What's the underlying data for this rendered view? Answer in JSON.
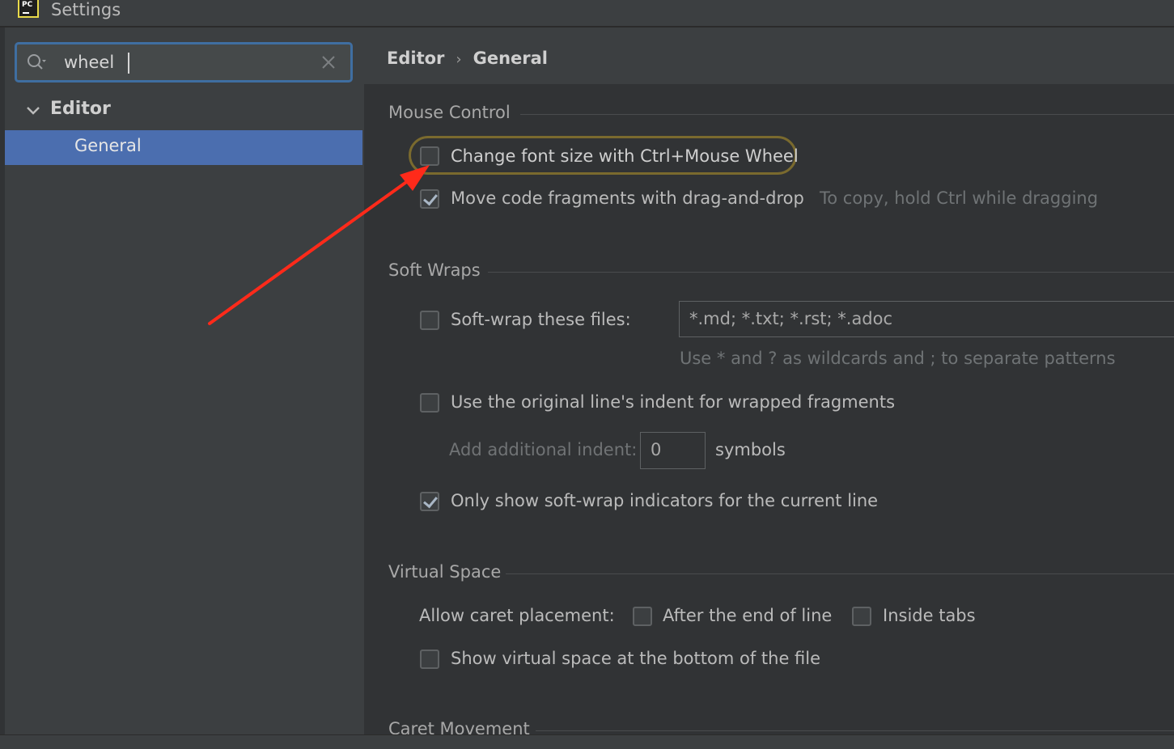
{
  "window": {
    "title": "Settings",
    "logo_text": "PC"
  },
  "search": {
    "value": "wheel",
    "placeholder": ""
  },
  "tree": {
    "editor": "Editor",
    "general": "General"
  },
  "breadcrumb": {
    "parent": "Editor",
    "separator": "›",
    "current": "General"
  },
  "mouse_control": {
    "title": "Mouse Control",
    "change_font": {
      "label": "Change font size with Ctrl+Mouse Wheel",
      "checked": false
    },
    "move_code": {
      "label": "Move code fragments with drag-and-drop",
      "checked": true,
      "hint": "To copy, hold Ctrl while dragging"
    }
  },
  "soft_wraps": {
    "title": "Soft Wraps",
    "soft_wrap_files": {
      "label": "Soft-wrap these files:",
      "checked": false,
      "value": "*.md; *.txt; *.rst; *.adoc",
      "hint": "Use * and ? as wildcards and ; to separate patterns"
    },
    "original_indent": {
      "label": "Use the original line's indent for wrapped fragments",
      "checked": false
    },
    "additional_indent": {
      "label": "Add additional indent:",
      "value": "0",
      "unit": "symbols"
    },
    "only_show": {
      "label": "Only show soft-wrap indicators for the current line",
      "checked": true
    }
  },
  "virtual_space": {
    "title": "Virtual Space",
    "caret_label": "Allow caret placement:",
    "after_end": {
      "label": "After the end of line",
      "checked": false
    },
    "inside_tabs": {
      "label": "Inside tabs",
      "checked": false
    },
    "show_virtual": {
      "label": "Show virtual space at the bottom of the file",
      "checked": false
    }
  },
  "caret_movement": {
    "title": "Caret Movement"
  },
  "colors": {
    "selection": "#4b6eaf",
    "highlight": "#7a6a2e",
    "arrow": "#ff2a1a",
    "focus": "#3f6ea1"
  }
}
